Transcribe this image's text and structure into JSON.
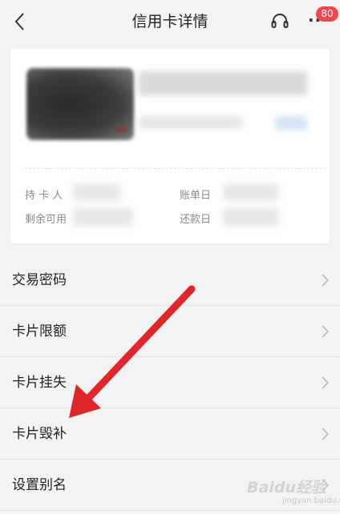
{
  "header": {
    "title": "信用卡详情",
    "back_icon": "chevron-left-icon",
    "service_icon": "headset-icon",
    "more_icon": "more-dots-icon",
    "more_label": "···",
    "badge_count": "80"
  },
  "card": {
    "holder_label": "持 卡 人",
    "available_label": "剩余可用",
    "bill_day_label": "账单日",
    "repay_day_label": "还款日"
  },
  "menu": {
    "items": [
      {
        "label": "交易密码"
      },
      {
        "label": "卡片限额"
      },
      {
        "label": "卡片挂失"
      },
      {
        "label": "卡片毁补"
      },
      {
        "label": "设置别名"
      }
    ]
  },
  "colors": {
    "background": "#f3f3f3",
    "badge": "#f0484e",
    "annotation_arrow": "#e0262a"
  },
  "watermark": {
    "main": "Baidu经验",
    "sub": "jingyan.baidu.com"
  }
}
